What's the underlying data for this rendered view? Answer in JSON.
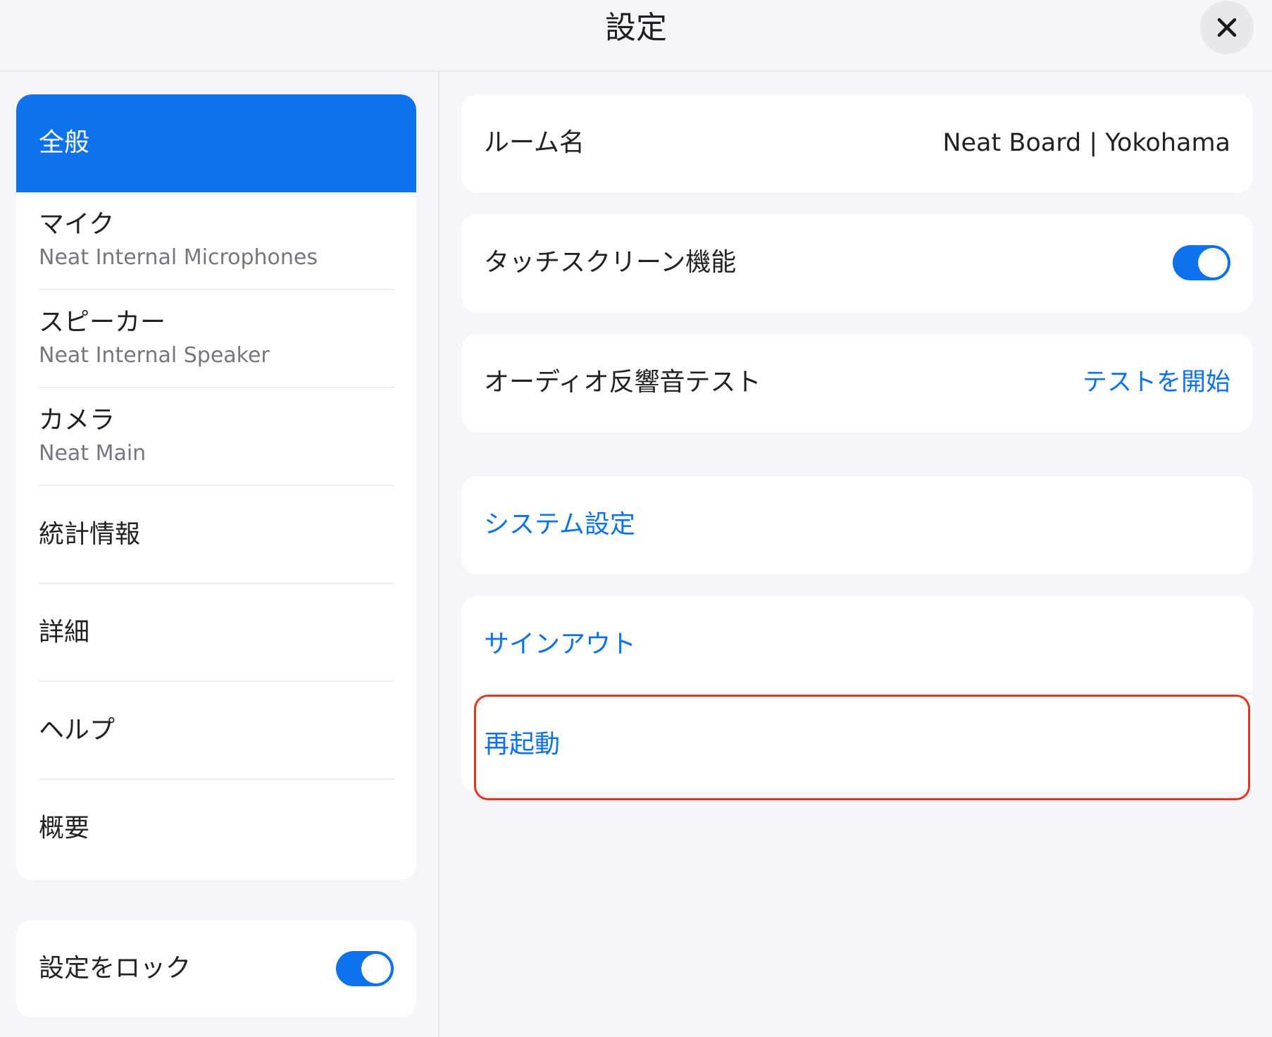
{
  "header": {
    "title": "設定"
  },
  "sidebar": {
    "items": [
      {
        "label": "全般",
        "sub": ""
      },
      {
        "label": "マイク",
        "sub": "Neat Internal Microphones"
      },
      {
        "label": "スピーカー",
        "sub": "Neat Internal Speaker"
      },
      {
        "label": "カメラ",
        "sub": "Neat Main"
      },
      {
        "label": "統計情報",
        "sub": ""
      },
      {
        "label": "詳細",
        "sub": ""
      },
      {
        "label": "ヘルプ",
        "sub": ""
      },
      {
        "label": "概要",
        "sub": ""
      }
    ],
    "lock": {
      "label": "設定をロック",
      "enabled": true
    }
  },
  "main": {
    "room": {
      "label": "ルーム名",
      "value": "Neat Board | Yokohama"
    },
    "touch": {
      "label": "タッチスクリーン機能",
      "enabled": true
    },
    "echo": {
      "label": "オーディオ反響音テスト",
      "action": "テストを開始"
    },
    "system_settings": {
      "label": "システム設定"
    },
    "sign_out": {
      "label": "サインアウト"
    },
    "restart": {
      "label": "再起動"
    }
  },
  "colors": {
    "accent": "#0e72ed",
    "background": "#f6f6fa",
    "highlight": "#e8341c"
  },
  "icons": {
    "close": "close-icon"
  }
}
